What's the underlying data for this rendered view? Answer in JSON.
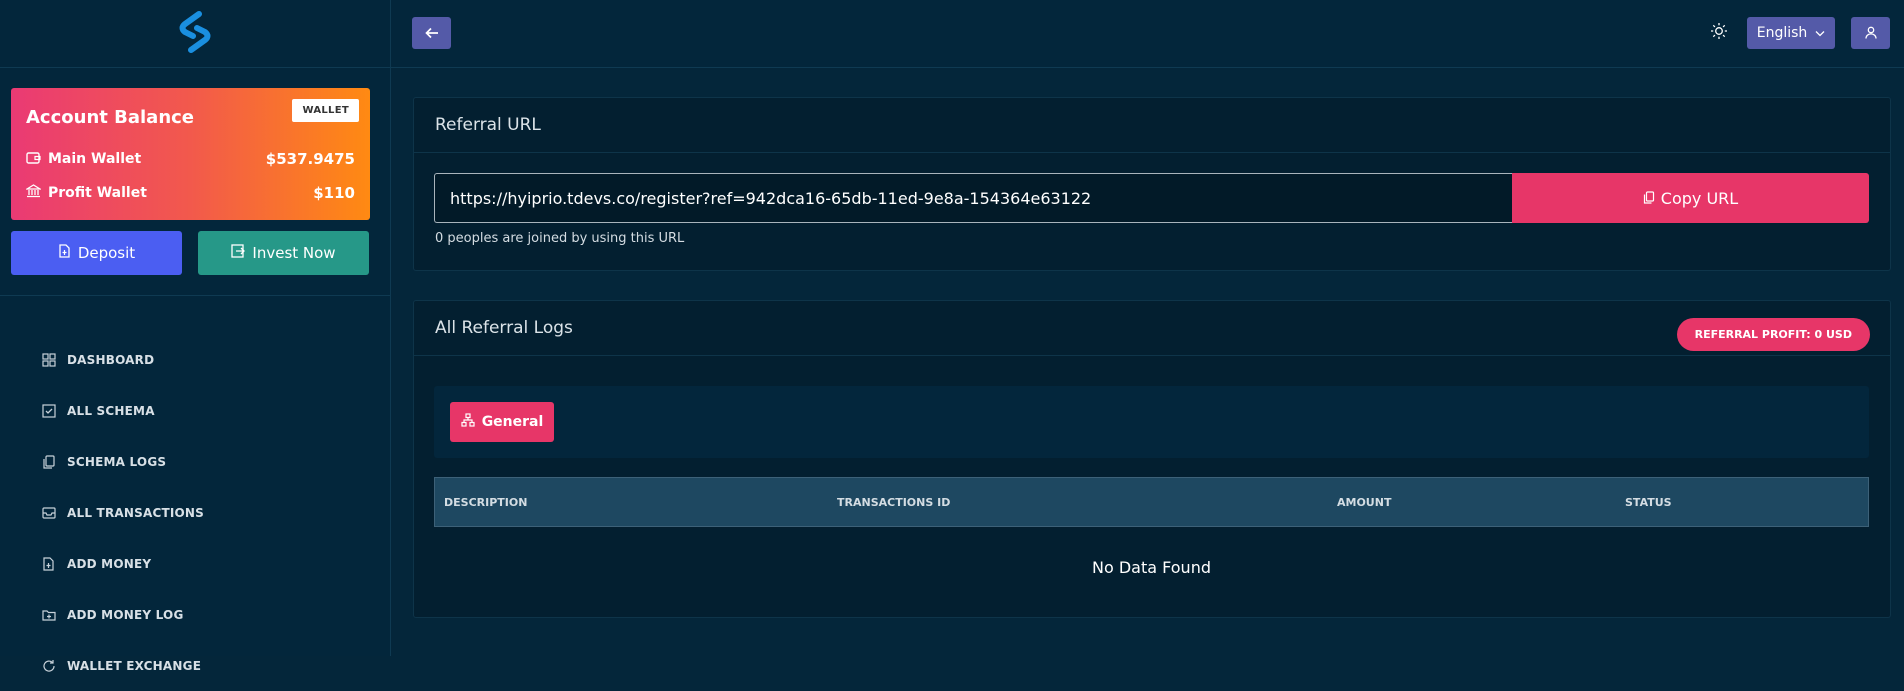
{
  "sidebar": {
    "balance_card": {
      "title": "Account Balance",
      "badge": "WALLET",
      "main_wallet_label": "Main Wallet",
      "main_wallet_value": "$537.9475",
      "profit_wallet_label": "Profit Wallet",
      "profit_wallet_value": "$110"
    },
    "deposit_label": "Deposit",
    "invest_label": "Invest Now",
    "nav": [
      {
        "label": "DASHBOARD",
        "icon": "grid-icon"
      },
      {
        "label": "ALL SCHEMA",
        "icon": "checkbox-icon"
      },
      {
        "label": "SCHEMA LOGS",
        "icon": "copy-icon"
      },
      {
        "label": "ALL TRANSACTIONS",
        "icon": "inbox-icon"
      },
      {
        "label": "ADD MONEY",
        "icon": "file-plus-icon"
      },
      {
        "label": "ADD MONEY LOG",
        "icon": "folder-plus-icon"
      },
      {
        "label": "WALLET EXCHANGE",
        "icon": "refresh-icon"
      }
    ]
  },
  "topbar": {
    "language": "English"
  },
  "referral_url": {
    "title": "Referral URL",
    "url": "https://hyiprio.tdevs.co/register?ref=942dca16-65db-11ed-9e8a-154364e63122",
    "copy_label": "Copy URL",
    "joined_text": "0 peoples are joined by using this URL"
  },
  "referral_logs": {
    "title": "All Referral Logs",
    "profit_badge": "REFERRAL PROFIT: 0 USD",
    "tab_general": "General",
    "columns": [
      "DESCRIPTION",
      "TRANSACTIONS ID",
      "AMOUNT",
      "STATUS"
    ],
    "empty_text": "No Data Found"
  },
  "colors": {
    "accent_pink": "#e73668",
    "deposit_blue": "#4b5ef2",
    "invest_teal": "#269888",
    "topbar_button": "#545aa8",
    "logo_blue": "#1a8fe0"
  }
}
